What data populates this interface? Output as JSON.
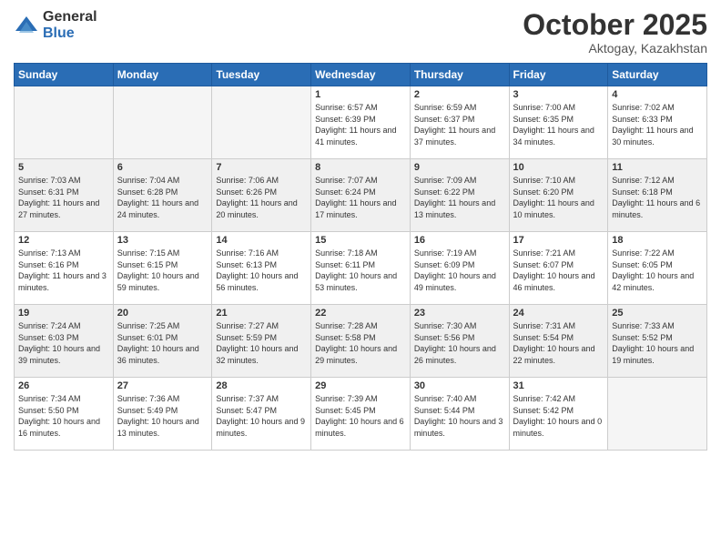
{
  "logo": {
    "general": "General",
    "blue": "Blue"
  },
  "title": "October 2025",
  "location": "Aktogay, Kazakhstan",
  "days_of_week": [
    "Sunday",
    "Monday",
    "Tuesday",
    "Wednesday",
    "Thursday",
    "Friday",
    "Saturday"
  ],
  "weeks": [
    [
      {
        "day": "",
        "empty": true
      },
      {
        "day": "",
        "empty": true
      },
      {
        "day": "",
        "empty": true
      },
      {
        "day": "1",
        "sunrise": "6:57 AM",
        "sunset": "6:39 PM",
        "daylight": "11 hours and 41 minutes."
      },
      {
        "day": "2",
        "sunrise": "6:59 AM",
        "sunset": "6:37 PM",
        "daylight": "11 hours and 37 minutes."
      },
      {
        "day": "3",
        "sunrise": "7:00 AM",
        "sunset": "6:35 PM",
        "daylight": "11 hours and 34 minutes."
      },
      {
        "day": "4",
        "sunrise": "7:02 AM",
        "sunset": "6:33 PM",
        "daylight": "11 hours and 30 minutes."
      }
    ],
    [
      {
        "day": "5",
        "sunrise": "7:03 AM",
        "sunset": "6:31 PM",
        "daylight": "11 hours and 27 minutes."
      },
      {
        "day": "6",
        "sunrise": "7:04 AM",
        "sunset": "6:28 PM",
        "daylight": "11 hours and 24 minutes."
      },
      {
        "day": "7",
        "sunrise": "7:06 AM",
        "sunset": "6:26 PM",
        "daylight": "11 hours and 20 minutes."
      },
      {
        "day": "8",
        "sunrise": "7:07 AM",
        "sunset": "6:24 PM",
        "daylight": "11 hours and 17 minutes."
      },
      {
        "day": "9",
        "sunrise": "7:09 AM",
        "sunset": "6:22 PM",
        "daylight": "11 hours and 13 minutes."
      },
      {
        "day": "10",
        "sunrise": "7:10 AM",
        "sunset": "6:20 PM",
        "daylight": "11 hours and 10 minutes."
      },
      {
        "day": "11",
        "sunrise": "7:12 AM",
        "sunset": "6:18 PM",
        "daylight": "11 hours and 6 minutes."
      }
    ],
    [
      {
        "day": "12",
        "sunrise": "7:13 AM",
        "sunset": "6:16 PM",
        "daylight": "11 hours and 3 minutes."
      },
      {
        "day": "13",
        "sunrise": "7:15 AM",
        "sunset": "6:15 PM",
        "daylight": "10 hours and 59 minutes."
      },
      {
        "day": "14",
        "sunrise": "7:16 AM",
        "sunset": "6:13 PM",
        "daylight": "10 hours and 56 minutes."
      },
      {
        "day": "15",
        "sunrise": "7:18 AM",
        "sunset": "6:11 PM",
        "daylight": "10 hours and 53 minutes."
      },
      {
        "day": "16",
        "sunrise": "7:19 AM",
        "sunset": "6:09 PM",
        "daylight": "10 hours and 49 minutes."
      },
      {
        "day": "17",
        "sunrise": "7:21 AM",
        "sunset": "6:07 PM",
        "daylight": "10 hours and 46 minutes."
      },
      {
        "day": "18",
        "sunrise": "7:22 AM",
        "sunset": "6:05 PM",
        "daylight": "10 hours and 42 minutes."
      }
    ],
    [
      {
        "day": "19",
        "sunrise": "7:24 AM",
        "sunset": "6:03 PM",
        "daylight": "10 hours and 39 minutes."
      },
      {
        "day": "20",
        "sunrise": "7:25 AM",
        "sunset": "6:01 PM",
        "daylight": "10 hours and 36 minutes."
      },
      {
        "day": "21",
        "sunrise": "7:27 AM",
        "sunset": "5:59 PM",
        "daylight": "10 hours and 32 minutes."
      },
      {
        "day": "22",
        "sunrise": "7:28 AM",
        "sunset": "5:58 PM",
        "daylight": "10 hours and 29 minutes."
      },
      {
        "day": "23",
        "sunrise": "7:30 AM",
        "sunset": "5:56 PM",
        "daylight": "10 hours and 26 minutes."
      },
      {
        "day": "24",
        "sunrise": "7:31 AM",
        "sunset": "5:54 PM",
        "daylight": "10 hours and 22 minutes."
      },
      {
        "day": "25",
        "sunrise": "7:33 AM",
        "sunset": "5:52 PM",
        "daylight": "10 hours and 19 minutes."
      }
    ],
    [
      {
        "day": "26",
        "sunrise": "7:34 AM",
        "sunset": "5:50 PM",
        "daylight": "10 hours and 16 minutes."
      },
      {
        "day": "27",
        "sunrise": "7:36 AM",
        "sunset": "5:49 PM",
        "daylight": "10 hours and 13 minutes."
      },
      {
        "day": "28",
        "sunrise": "7:37 AM",
        "sunset": "5:47 PM",
        "daylight": "10 hours and 9 minutes."
      },
      {
        "day": "29",
        "sunrise": "7:39 AM",
        "sunset": "5:45 PM",
        "daylight": "10 hours and 6 minutes."
      },
      {
        "day": "30",
        "sunrise": "7:40 AM",
        "sunset": "5:44 PM",
        "daylight": "10 hours and 3 minutes."
      },
      {
        "day": "31",
        "sunrise": "7:42 AM",
        "sunset": "5:42 PM",
        "daylight": "10 hours and 0 minutes."
      },
      {
        "day": "",
        "empty": true
      }
    ]
  ]
}
